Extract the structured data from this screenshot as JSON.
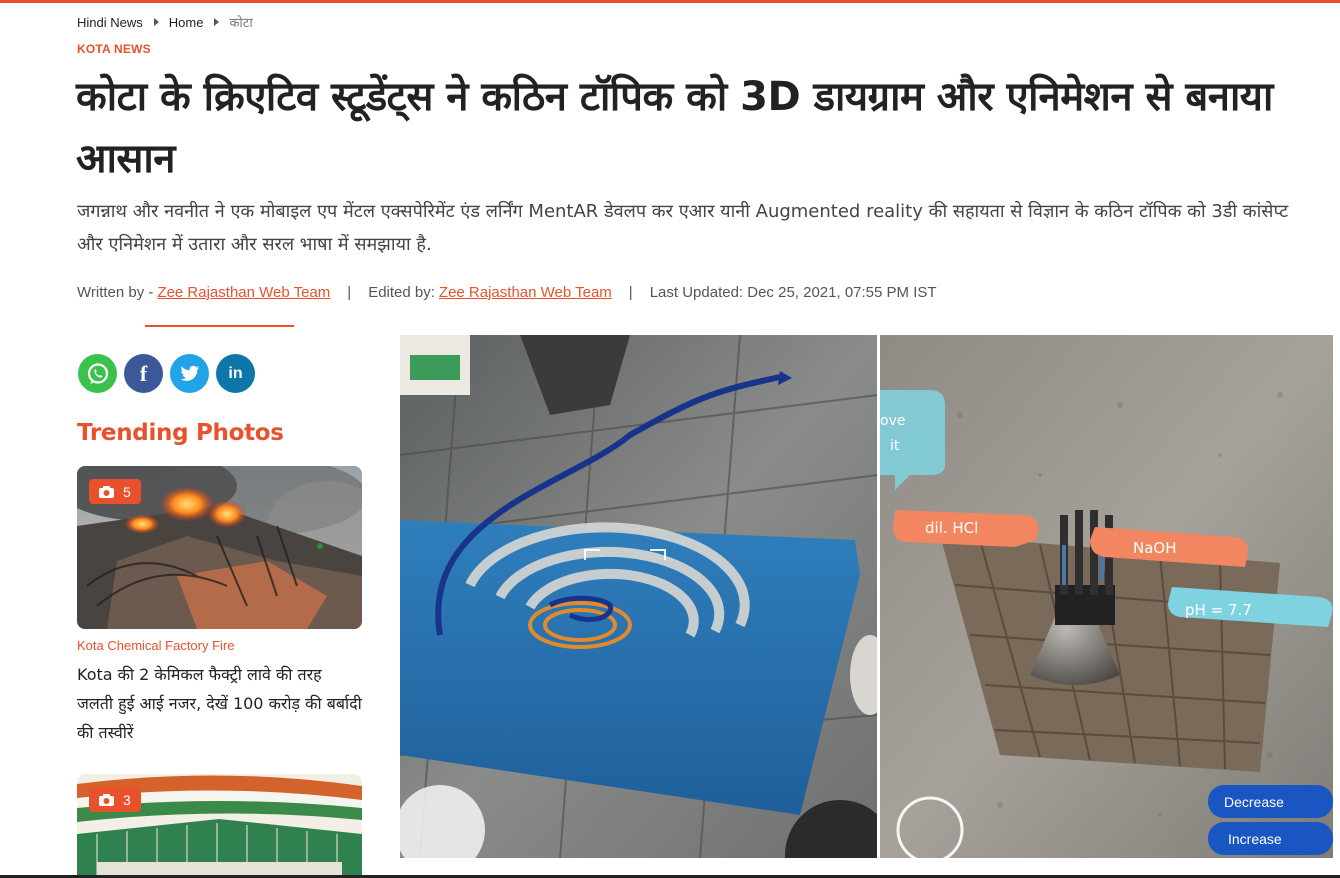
{
  "breadcrumb": {
    "items": [
      "Hindi News",
      "Home"
    ],
    "current": "कोटा"
  },
  "article": {
    "section": "KOTA NEWS",
    "headline": "कोटा के क्रिएटिव स्टूडेंट्स ने कठिन टॉपिक को 3D डायग्राम और एनिमेशन से बनाया आसान",
    "summary": "जगन्नाथ और नवनीत ने एक मोबाइल एप मेंटल एक्सपेरिमेंट एंड लर्निंग MentAR डेवलप कर एआर यानी Augmented reality की सहायता से विज्ञान के कठिन टॉपिक को 3डी कांसेप्ट और एनिमेशन में उतारा और सरल भाषा में समझाया है.",
    "byline": {
      "written_label": "Written by -",
      "written_name": "Zee Rajasthan Web Team",
      "edited_label": "Edited by:",
      "edited_name": "Zee Rajasthan Web Team",
      "updated": "Last Updated: Dec 25, 2021, 07:55 PM IST",
      "separator": "|"
    }
  },
  "share": {
    "icons": [
      "whatsapp-icon",
      "facebook-icon",
      "twitter-icon",
      "linkedin-icon"
    ],
    "facebook_glyph": "f",
    "linkedin_glyph": "in"
  },
  "trending": {
    "title": "Trending Photos",
    "cards": [
      {
        "photo_count": "5",
        "category": "Kota Chemical Factory Fire",
        "title": "Kota की 2 केमिकल फैक्ट्री लावे की तरह जलती हुई आई नजर, देखें 100 करोड़ की बर्बादी की तस्वीरें"
      },
      {
        "photo_count": "3"
      }
    ]
  },
  "ar_image": {
    "labels": {
      "move_tip_1": "ove",
      "move_tip_2": "it",
      "hcl": "dil. HCl",
      "naoh": "NaOH",
      "ph": "pH = 7.7",
      "decrease": "Decrease",
      "increase": "Increase"
    }
  },
  "colors": {
    "accent": "#e8512c",
    "link": "#e8512c",
    "whatsapp": "#3bc24d",
    "facebook": "#3b5998",
    "twitter": "#22a3e8",
    "linkedin": "#0e76a8"
  }
}
